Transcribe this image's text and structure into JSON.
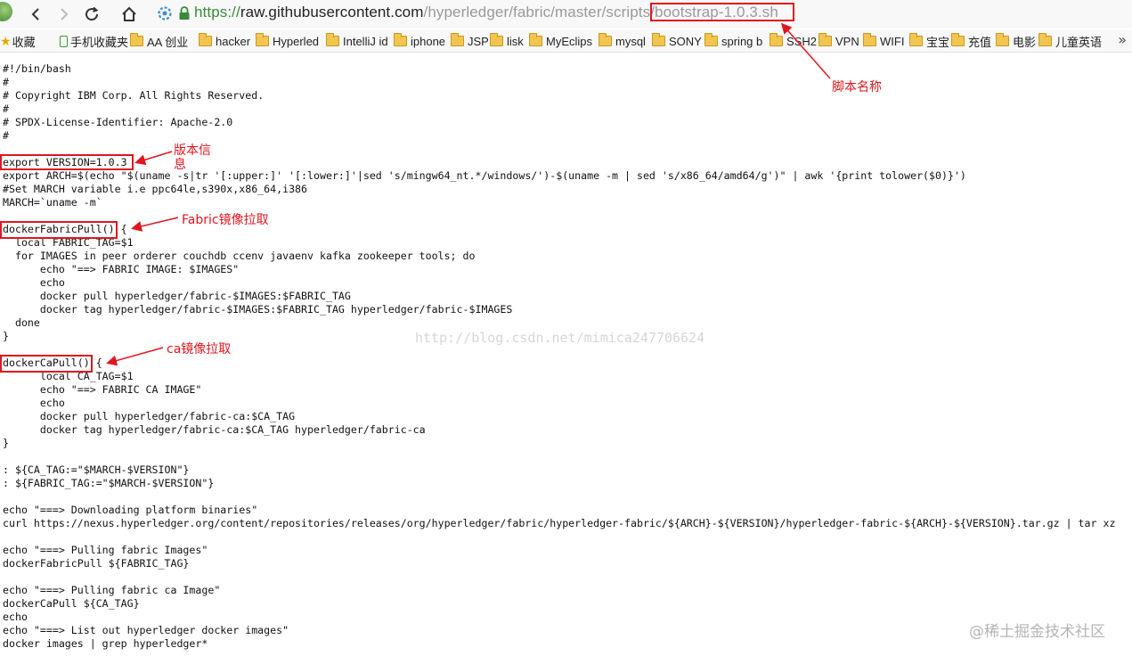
{
  "browser": {
    "url_scheme": "https://",
    "url_host": "raw.githubusercontent.com",
    "url_path": "/hyperledger/fabric/master/scripts/",
    "url_file": "bootstrap-1.0.3.sh"
  },
  "bookmarks": [
    {
      "label": "收藏",
      "icon": "star-icon"
    },
    {
      "label": "手机收藏夹",
      "icon": "phone-icon"
    },
    {
      "label": "AA 创业",
      "icon": "folder-icon"
    },
    {
      "label": "hacker",
      "icon": "folder-icon"
    },
    {
      "label": "Hyperled",
      "icon": "folder-icon"
    },
    {
      "label": "IntelliJ id",
      "icon": "folder-icon"
    },
    {
      "label": "iphone",
      "icon": "folder-icon"
    },
    {
      "label": "JSP",
      "icon": "folder-icon"
    },
    {
      "label": "lisk",
      "icon": "folder-icon"
    },
    {
      "label": "MyEclips",
      "icon": "folder-icon"
    },
    {
      "label": "mysql",
      "icon": "folder-icon"
    },
    {
      "label": "SONY",
      "icon": "folder-icon"
    },
    {
      "label": "spring b",
      "icon": "folder-icon"
    },
    {
      "label": "SSH2",
      "icon": "folder-icon"
    },
    {
      "label": "VPN",
      "icon": "folder-icon"
    },
    {
      "label": "WIFI",
      "icon": "folder-icon"
    },
    {
      "label": "宝宝",
      "icon": "folder-icon"
    },
    {
      "label": "充值",
      "icon": "folder-icon"
    },
    {
      "label": "电影",
      "icon": "folder-icon"
    },
    {
      "label": "儿童英语",
      "icon": "folder-icon"
    }
  ],
  "bookmarks_more": "»",
  "code_lines": [
    "#!/bin/bash",
    "#",
    "# Copyright IBM Corp. All Rights Reserved.",
    "#",
    "# SPDX-License-Identifier: Apache-2.0",
    "#",
    "",
    "export VERSION=1.0.3",
    "export ARCH=$(echo \"$(uname -s|tr '[:upper:]' '[:lower:]'|sed 's/mingw64_nt.*/windows/')-$(uname -m | sed 's/x86_64/amd64/g')\" | awk '{print tolower($0)}')",
    "#Set MARCH variable i.e ppc64le,s390x,x86_64,i386",
    "MARCH=`uname -m`",
    "",
    "dockerFabricPull() {",
    "  local FABRIC_TAG=$1",
    "  for IMAGES in peer orderer couchdb ccenv javaenv kafka zookeeper tools; do",
    "      echo \"==> FABRIC IMAGE: $IMAGES\"",
    "      echo",
    "      docker pull hyperledger/fabric-$IMAGES:$FABRIC_TAG",
    "      docker tag hyperledger/fabric-$IMAGES:$FABRIC_TAG hyperledger/fabric-$IMAGES",
    "  done",
    "}",
    "",
    "dockerCaPull() {",
    "      local CA_TAG=$1",
    "      echo \"==> FABRIC CA IMAGE\"",
    "      echo",
    "      docker pull hyperledger/fabric-ca:$CA_TAG",
    "      docker tag hyperledger/fabric-ca:$CA_TAG hyperledger/fabric-ca",
    "}",
    "",
    ": ${CA_TAG:=\"$MARCH-$VERSION\"}",
    ": ${FABRIC_TAG:=\"$MARCH-$VERSION\"}",
    "",
    "echo \"===> Downloading platform binaries\"",
    "curl https://nexus.hyperledger.org/content/repositories/releases/org/hyperledger/fabric/hyperledger-fabric/${ARCH}-${VERSION}/hyperledger-fabric-${ARCH}-${VERSION}.tar.gz | tar xz",
    "",
    "echo \"===> Pulling fabric Images\"",
    "dockerFabricPull ${FABRIC_TAG}",
    "",
    "echo \"===> Pulling fabric ca Image\"",
    "dockerCaPull ${CA_TAG}",
    "echo",
    "echo \"===> List out hyperledger docker images\"",
    "docker images | grep hyperledger*"
  ],
  "annotations": {
    "script_name": "脚本名称",
    "version_info_1": "版本信",
    "version_info_2": "息",
    "fabric_pull": "Fabric镜像拉取",
    "ca_pull": "ca镜像拉取"
  },
  "watermark": "http://blog.csdn.net/mimica247706624",
  "corner_watermark": "@稀土掘金技术社区",
  "colors": {
    "annotation_red": "#e0161e",
    "url_secure_green": "#3a8a3a"
  }
}
